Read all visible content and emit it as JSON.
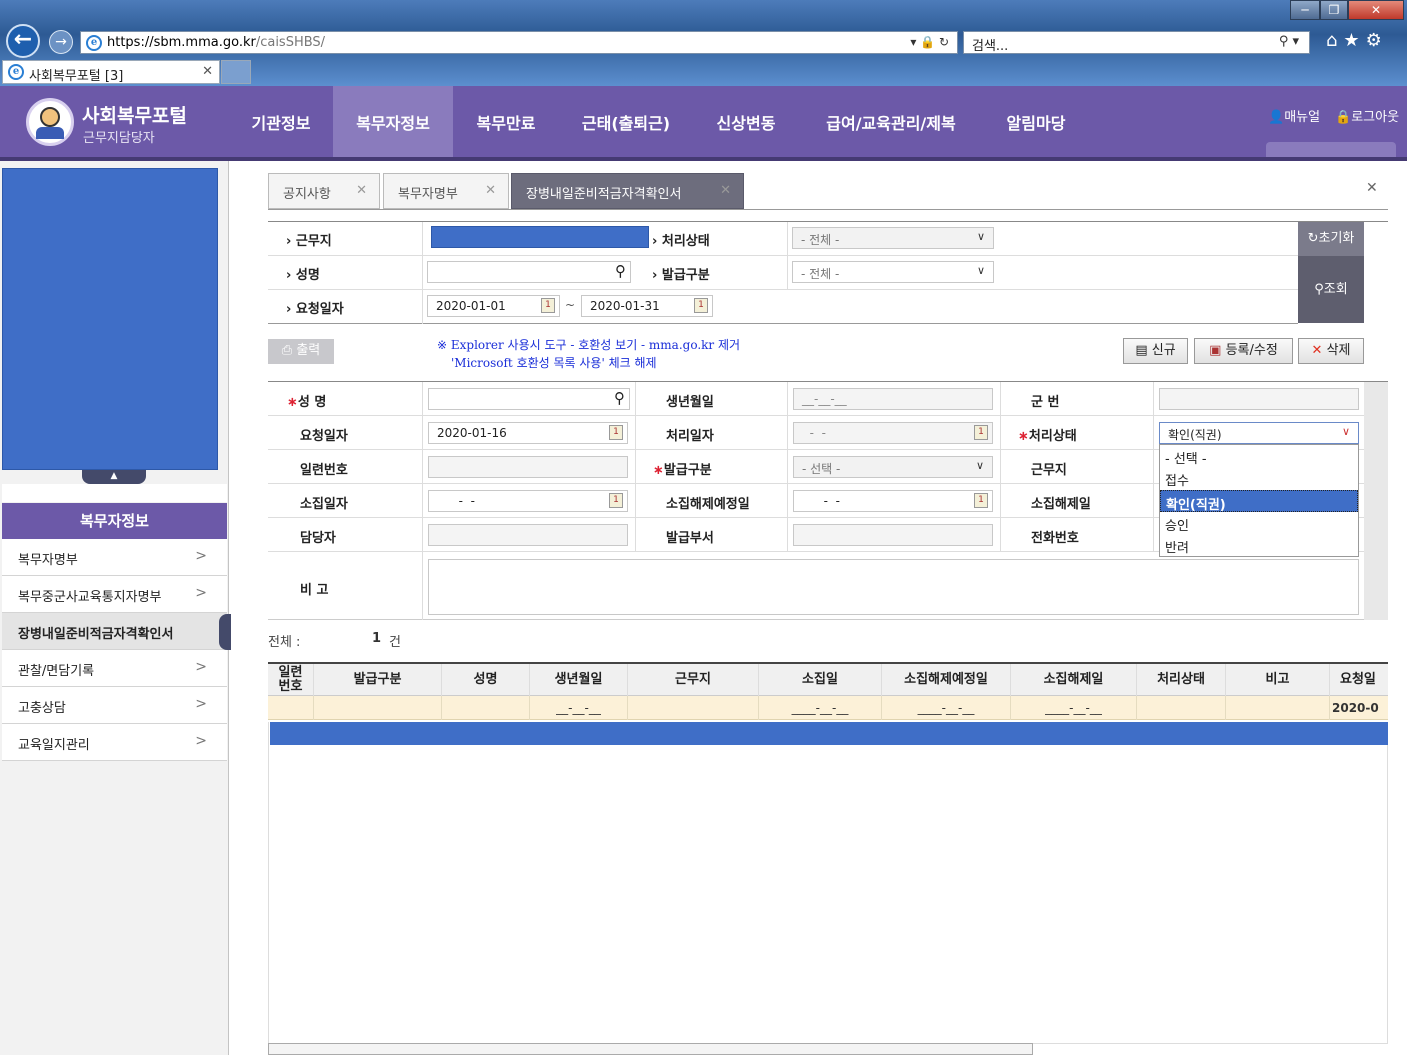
{
  "browser": {
    "url_domain": "https://sbm.mma.go.kr",
    "url_path": "/caisSHBS/",
    "search_placeholder": "검색...",
    "tab_title": "사회복무포털 [3]"
  },
  "header": {
    "title": "사회복무포털",
    "subtitle": "근무지담당자",
    "menu": [
      "기관정보",
      "복무자정보",
      "복무만료",
      "근태(출퇴근)",
      "신상변동",
      "급여/교육관리/제복",
      "알림마당"
    ],
    "active_menu": 1,
    "manual_label": "매뉴얼",
    "logout_label": "로그아웃"
  },
  "sidebar": {
    "heading": "복무자정보",
    "items": [
      "복무자명부",
      "복무중군사교육통지자명부",
      "장병내일준비적금자격확인서",
      "관찰/면담기록",
      "고충상담",
      "교육일지관리"
    ],
    "active": 2
  },
  "tabs": [
    "공지사항",
    "복무자명부",
    "장병내일준비적금자격확인서"
  ],
  "search_form": {
    "workplace_label": "근무지",
    "status_label": "처리상태",
    "status_value": "- 전체 -",
    "name_label": "성명",
    "issue_type_label": "발급구분",
    "issue_type_value": "- 전체 -",
    "request_date_label": "요청일자",
    "date_from": "2020-01-01",
    "date_sep": "~",
    "date_to": "2020-01-31",
    "reset_label": "초기화",
    "search_label": "조회"
  },
  "toolbar": {
    "print_label": "출력",
    "notice_line1": "※ Explorer 사용시 도구 - 호환성 보기 - mma.go.kr 제거",
    "notice_line2": "'Microsoft 호환성 목록 사용' 체크 해제",
    "new_label": "신규",
    "save_label": "등록/수정",
    "delete_label": "삭제"
  },
  "detail_form": {
    "name_label": "성 명",
    "birth_label": "생년월일",
    "birth_value": "__-__-__",
    "army_no_label": "군 번",
    "request_date_label": "요청일자",
    "request_date_value": "2020-01-16",
    "process_date_label": "처리일자",
    "process_date_value": "  -  -",
    "status_label": "처리상태",
    "status_value": "확인(직권)",
    "serial_label": "일련번호",
    "issue_type_label": "발급구분",
    "issue_type_value": "- 선택 -",
    "workplace_label": "근무지",
    "call_date_label": "소집일자",
    "call_date_value": "  -  -",
    "release_plan_label": "소집해제예정일",
    "release_plan_value": "  -  -",
    "release_label": "소집해제일",
    "manager_label": "담당자",
    "issue_dept_label": "발급부서",
    "phone_label": "전화번호",
    "remark_label": "비 고"
  },
  "status_dropdown": {
    "options": [
      "- 선택 -",
      "접수",
      "확인(직권)",
      "승인",
      "반려"
    ],
    "selected": 2
  },
  "grid": {
    "total_label": "전체 :",
    "total_count": "1",
    "total_unit": "건",
    "headers": [
      "일련\n번호",
      "발급구분",
      "성명",
      "생년월일",
      "근무지",
      "소집일",
      "소집해제예정일",
      "소집해제일",
      "처리상태",
      "비고",
      "요청일"
    ],
    "row": [
      "",
      "",
      "",
      "__-__-__",
      "",
      "____-__-__",
      "____-__-__",
      "____-__-__",
      "",
      "",
      "2020-0"
    ]
  }
}
